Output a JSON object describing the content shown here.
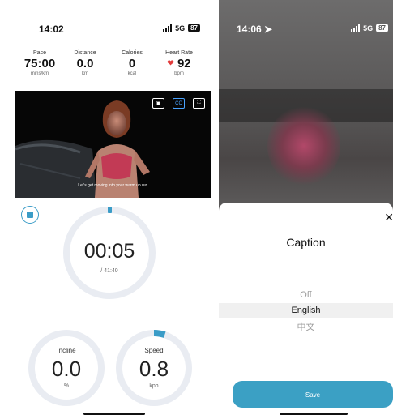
{
  "left": {
    "status": {
      "time": "14:02",
      "network": "5G",
      "battery": "87"
    },
    "metrics": [
      {
        "label": "Pace",
        "value": "75:00",
        "unit": "mins/km"
      },
      {
        "label": "Distance",
        "value": "0.0",
        "unit": "km"
      },
      {
        "label": "Calories",
        "value": "0",
        "unit": "kcal"
      },
      {
        "label": "Heart Rate",
        "value": "92",
        "unit": "bpm",
        "icon": "heart-icon"
      }
    ],
    "video": {
      "subtitle": "Let's get moving into your warm up run.",
      "cc_label": "CC"
    },
    "timer": {
      "elapsed": "00:05",
      "total": "/ 41:40",
      "progress": 0.002
    },
    "incline": {
      "label": "Incline",
      "value": "0.0",
      "unit": "%"
    },
    "speed": {
      "label": "Speed",
      "value": "0.8",
      "unit": "kph",
      "progress": 0.05
    },
    "colors": {
      "accent": "#3a9cc7",
      "ring": "#e9ecf2",
      "heart": "#e23b3b"
    }
  },
  "right": {
    "status": {
      "time": "14:06",
      "network": "5G",
      "battery": "87"
    },
    "sheet": {
      "title": "Caption",
      "close_icon": "close-icon",
      "options": [
        "Off",
        "English",
        "中文"
      ],
      "selected": "English",
      "save_label": "Save"
    },
    "colors": {
      "save": "#3ba0c4"
    }
  }
}
